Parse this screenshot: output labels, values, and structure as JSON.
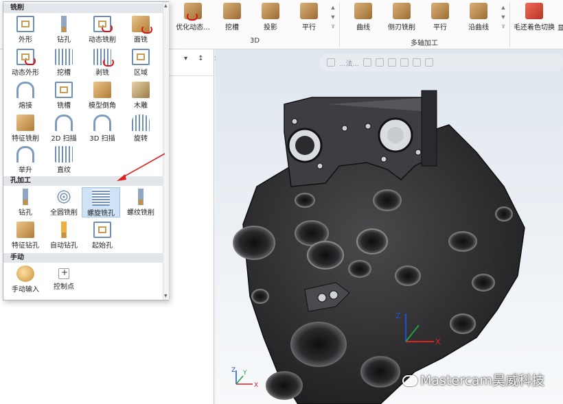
{
  "ribbon": {
    "buttons": [
      {
        "label": "优化动态..."
      },
      {
        "label": "挖槽"
      },
      {
        "label": "投影"
      },
      {
        "label": "平行"
      },
      {
        "label": "曲线"
      },
      {
        "label": "侧刃铣削"
      },
      {
        "label": "平行"
      },
      {
        "label": "沿曲线"
      },
      {
        "label": "毛还着色切换"
      }
    ],
    "groups": {
      "g3d": "3D",
      "multiaxis": "多轴加工"
    },
    "edge_char": "显"
  },
  "viewport": {
    "toolbar": {
      "label": "...法..."
    },
    "watermark": "Mastercam昊威科技",
    "axis": {
      "x": "X",
      "y": "Y",
      "z": "Z"
    }
  },
  "panel": {
    "controls": "▾ ↕ ×"
  },
  "flyout": {
    "sections": [
      {
        "title": "铣削"
      },
      {
        "title": "孔加工"
      },
      {
        "title": "手动"
      }
    ],
    "milling": [
      {
        "label": "外形",
        "icon": "contour-icon"
      },
      {
        "label": "钻孔",
        "icon": "drill-icon"
      },
      {
        "label": "动态铣削",
        "icon": "dynamic-mill-icon"
      },
      {
        "label": "面铣",
        "icon": "face-mill-icon"
      },
      {
        "label": "动态外形",
        "icon": "dynamic-contour-icon"
      },
      {
        "label": "挖槽",
        "icon": "pocket-icon"
      },
      {
        "label": "剥铣",
        "icon": "peel-mill-icon"
      },
      {
        "label": "区域",
        "icon": "area-icon"
      },
      {
        "label": "熔接",
        "icon": "blend-icon"
      },
      {
        "label": "铣槽",
        "icon": "slot-mill-icon"
      },
      {
        "label": "模型倒角",
        "icon": "model-chamfer-icon"
      },
      {
        "label": "木雕",
        "icon": "engrave-icon"
      },
      {
        "label": "特征铣削",
        "icon": "feature-mill-icon"
      },
      {
        "label": "2D 扫描",
        "icon": "sweep-2d-icon"
      },
      {
        "label": "3D 扫描",
        "icon": "sweep-3d-icon"
      },
      {
        "label": "旋转",
        "icon": "revolve-icon"
      },
      {
        "label": "举升",
        "icon": "loft-icon"
      },
      {
        "label": "直纹",
        "icon": "ruled-icon"
      }
    ],
    "holes": [
      {
        "label": "钻孔",
        "icon": "drill-icon"
      },
      {
        "label": "全圆铣削",
        "icon": "circle-mill-icon"
      },
      {
        "label": "螺旋铣孔",
        "icon": "helix-bore-icon",
        "selected": true
      },
      {
        "label": "螺纹铣削",
        "icon": "thread-mill-icon"
      },
      {
        "label": "特征钻孔",
        "icon": "feature-drill-icon"
      },
      {
        "label": "自动钻孔",
        "icon": "auto-drill-icon"
      },
      {
        "label": "起始孔",
        "icon": "start-hole-icon"
      }
    ],
    "manual": [
      {
        "label": "手动输入",
        "icon": "manual-entry-icon"
      },
      {
        "label": "控制点",
        "icon": "control-point-icon"
      }
    ]
  },
  "colors": {
    "accent": "#e02020",
    "selected": "#cfe3f7",
    "section": "#e2e6eb"
  }
}
